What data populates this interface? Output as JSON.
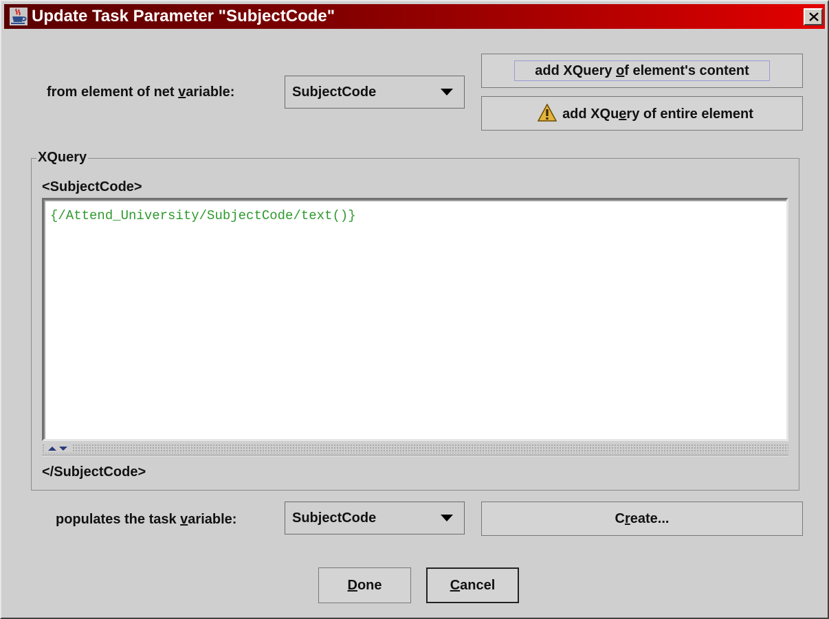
{
  "window": {
    "title": "Update Task Parameter \"SubjectCode\""
  },
  "source": {
    "label_pre": "from element of net ",
    "label_key": "v",
    "label_post": "ariable:",
    "selected": "SubjectCode"
  },
  "actions": {
    "add_content_pre": "add XQuery ",
    "add_content_key": "o",
    "add_content_post": "f element's content",
    "add_entire_pre": "add XQu",
    "add_entire_key": "e",
    "add_entire_post": "ry of entire element"
  },
  "xquery": {
    "group_title": "XQuery",
    "open_tag": "<SubjectCode>",
    "expression": "{/Attend_University/SubjectCode/text()}",
    "close_tag": "</SubjectCode>"
  },
  "target": {
    "label_pre": "populates the task ",
    "label_key": "v",
    "label_post": "ariable:",
    "selected": "SubjectCode",
    "create_pre": "C",
    "create_key": "r",
    "create_post": "eate..."
  },
  "footer": {
    "done_key": "D",
    "done_rest": "one",
    "cancel_key": "C",
    "cancel_rest": "ancel"
  },
  "colors": {
    "title_gradient_start": "#5a0000",
    "title_gradient_end": "#e40000",
    "xquery_text": "#2e9a2e",
    "dialog_bg": "#cfcfcf"
  },
  "icons": {
    "app": "java-cup-icon",
    "close": "close-icon",
    "warning": "warning-icon",
    "dropdown": "dropdown-arrow-icon"
  }
}
